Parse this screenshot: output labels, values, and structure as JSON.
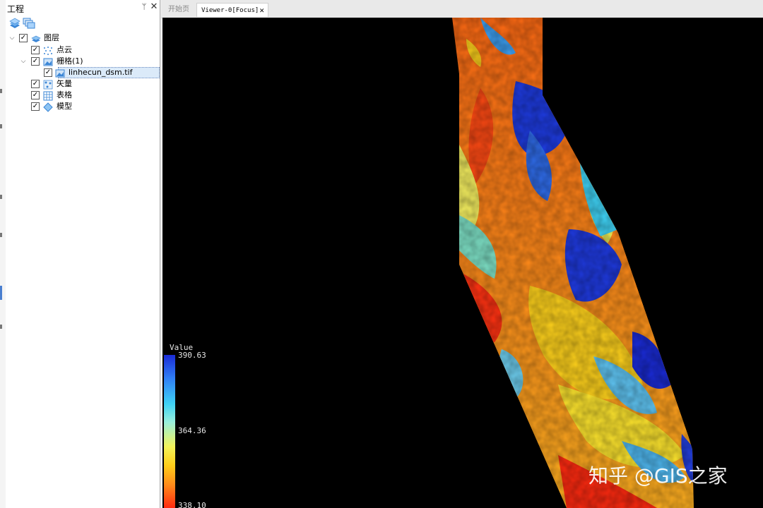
{
  "panel": {
    "title": "工程",
    "pin_label": "ᛘ",
    "close_label": "✕",
    "toolbar": [
      {
        "icon": "layer-stack-icon"
      },
      {
        "icon": "add-layers-icon"
      }
    ],
    "tree": [
      {
        "label": "图层",
        "icon": "layer-stack-icon",
        "checked": true,
        "expanded": true,
        "level": 0
      },
      {
        "label": "点云",
        "icon": "point-cloud-icon",
        "checked": true,
        "level": 1
      },
      {
        "label": "栅格(1)",
        "icon": "raster-icon",
        "checked": true,
        "expanded": true,
        "level": 1
      },
      {
        "label": "linhecun_dsm.tif",
        "icon": "raster-file-icon",
        "checked": true,
        "level": 2,
        "selected": true
      },
      {
        "label": "矢量",
        "icon": "vector-icon",
        "checked": true,
        "level": 1
      },
      {
        "label": "表格",
        "icon": "table-icon",
        "checked": true,
        "level": 1
      },
      {
        "label": "模型",
        "icon": "model-icon",
        "checked": true,
        "level": 1
      }
    ]
  },
  "tabs": {
    "start": "开始页",
    "viewer": "Viewer-0[Focus]",
    "close": "✕"
  },
  "legend": {
    "title": "Value",
    "max": "390.63",
    "mid": "364.36",
    "min": "338.10",
    "colors": [
      "#1a2bd6",
      "#3fd2f5",
      "#f3f35a",
      "#ff8a1a",
      "#ff2a10"
    ]
  },
  "watermark": "知乎 @GIS之家"
}
